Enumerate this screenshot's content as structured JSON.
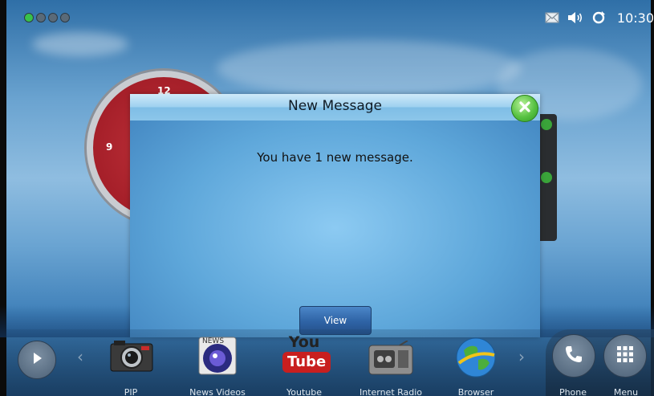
{
  "status_bar": {
    "indicators": [
      "green",
      "grey",
      "grey",
      "grey"
    ],
    "icons": [
      "message-icon",
      "volume-icon",
      "sync-icon"
    ],
    "time": "10:30"
  },
  "clock_widget": {
    "numbers": [
      "12",
      "9"
    ]
  },
  "dialog": {
    "title": "New Message",
    "message": "You have 1 new message.",
    "view_label": "View",
    "close_icon": "close-icon"
  },
  "dock": {
    "items": [
      {
        "label": "PIP",
        "icon": "camera-icon"
      },
      {
        "label": "News Videos",
        "icon": "news-videos-icon",
        "badge": "NEWS"
      },
      {
        "label": "Youtube",
        "icon": "youtube-icon",
        "logo_top": "You",
        "logo_bottom": "Tube"
      },
      {
        "label": "Internet Radio",
        "icon": "radio-icon"
      },
      {
        "label": "Browser",
        "icon": "globe-icon"
      }
    ],
    "right": [
      {
        "label": "Phone",
        "icon": "phone-icon"
      },
      {
        "label": "Menu",
        "icon": "grid-menu-icon"
      }
    ]
  },
  "colors": {
    "accent_green": "#58c242",
    "dialog_blue": "#5ea7da",
    "button_blue": "#2e63a5"
  }
}
